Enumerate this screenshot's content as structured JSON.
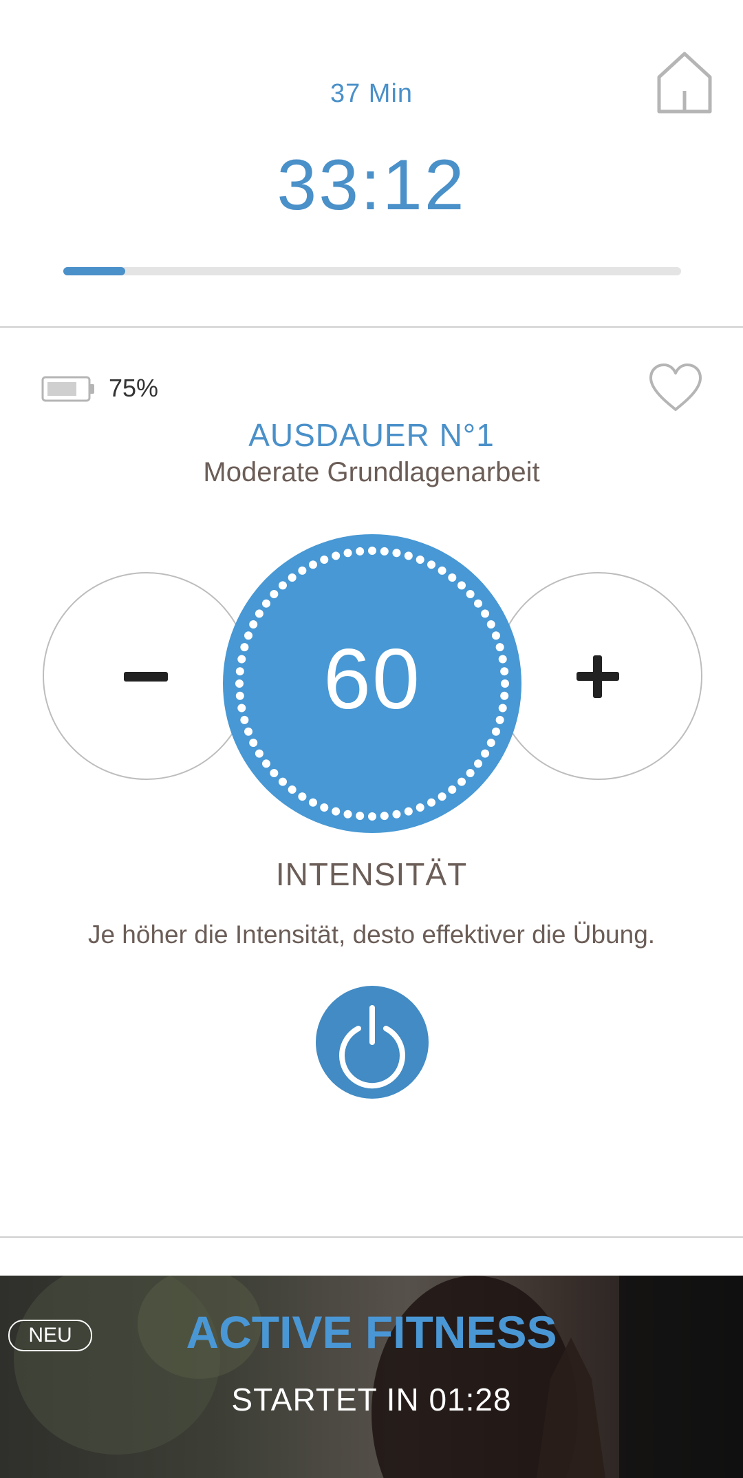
{
  "workout": {
    "duration_label": "37 Min",
    "remaining_time": "33:12",
    "progress_fraction": 0.1
  },
  "device": {
    "battery_label": "75%",
    "battery_fraction": 0.75
  },
  "program": {
    "title": "AUSDAUER N°1",
    "subtitle": "Moderate Grundlagenarbeit"
  },
  "intensity": {
    "value": "60",
    "label": "INTENSITÄT",
    "hint": "Je höher die Intensität, desto effektiver die Übung."
  },
  "promo": {
    "badge": "NEU",
    "title": "ACTIVE FITNESS",
    "subtitle": "STARTET IN 01:28"
  },
  "icons": {
    "home": "home-icon",
    "battery": "battery-icon",
    "favorite": "heart-icon",
    "decrease": "minus-icon",
    "increase": "plus-icon",
    "power": "power-icon"
  },
  "colors": {
    "accent": "#4a90c9",
    "dial": "#4798d4",
    "power": "#428bc4",
    "text": "#6b5d57"
  }
}
